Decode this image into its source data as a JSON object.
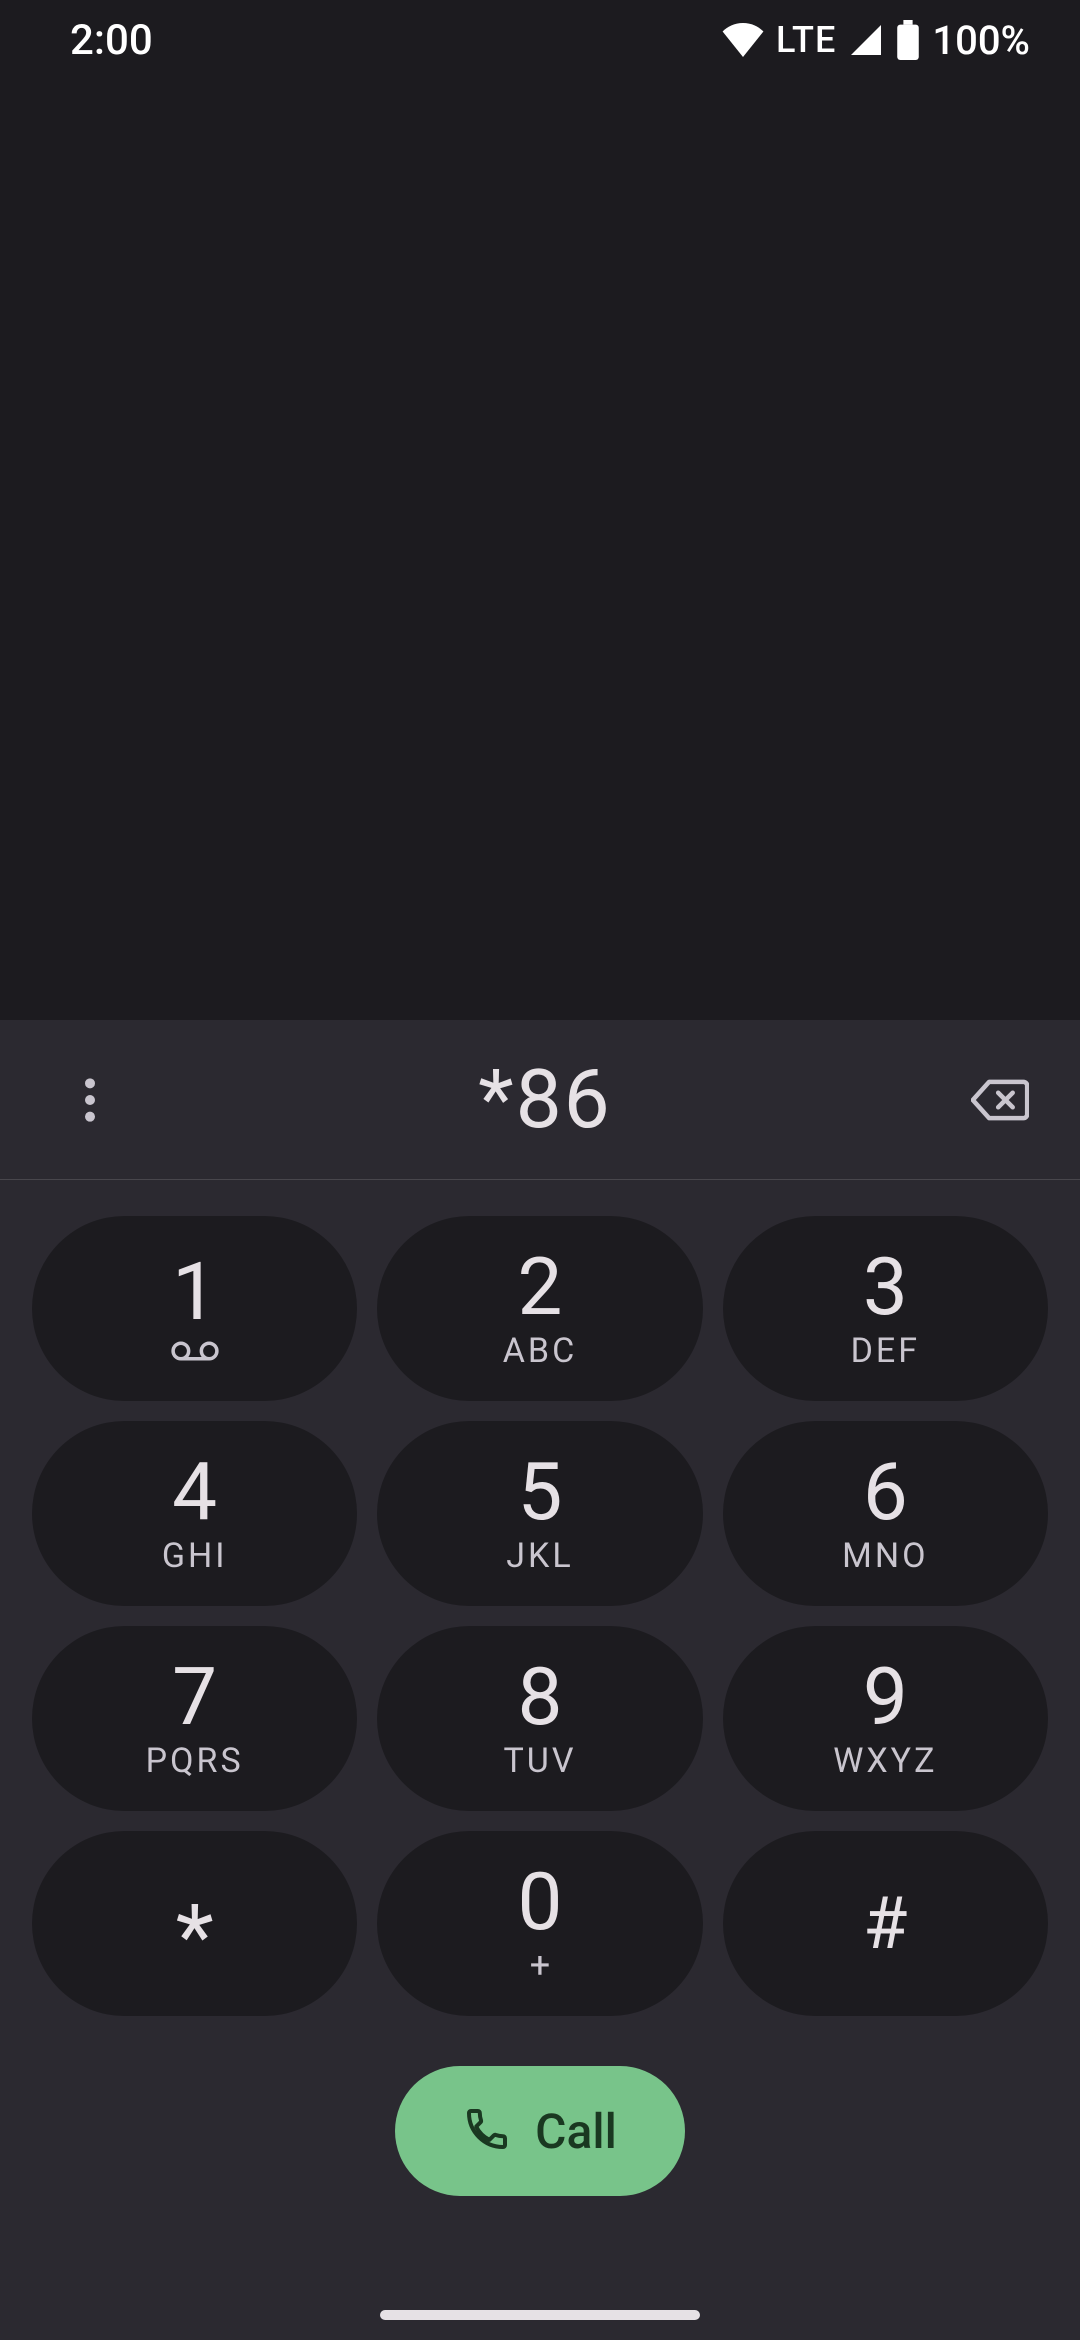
{
  "status_bar": {
    "time": "2:00",
    "network_type": "LTE",
    "battery_percent": "100%"
  },
  "dialer": {
    "entered_number": "*86",
    "keys": [
      {
        "digit": "1",
        "letters": ""
      },
      {
        "digit": "2",
        "letters": "ABC"
      },
      {
        "digit": "3",
        "letters": "DEF"
      },
      {
        "digit": "4",
        "letters": "GHI"
      },
      {
        "digit": "5",
        "letters": "JKL"
      },
      {
        "digit": "6",
        "letters": "MNO"
      },
      {
        "digit": "7",
        "letters": "PQRS"
      },
      {
        "digit": "8",
        "letters": "TUV"
      },
      {
        "digit": "9",
        "letters": "WXYZ"
      },
      {
        "digit": "*",
        "letters": ""
      },
      {
        "digit": "0",
        "letters": "+"
      },
      {
        "digit": "#",
        "letters": ""
      }
    ],
    "call_label": "Call"
  }
}
